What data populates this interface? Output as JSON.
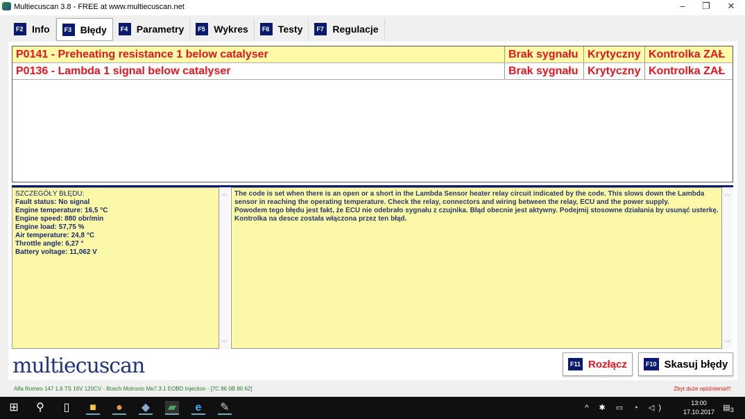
{
  "window": {
    "title": "Multiecuscan 3.8 - FREE at www.multiecuscan.net",
    "minimize": "–",
    "restore": "❐",
    "close": "✕"
  },
  "tabs": [
    {
      "key": "F2",
      "label": "Info"
    },
    {
      "key": "F3",
      "label": "Błędy"
    },
    {
      "key": "F4",
      "label": "Parametry"
    },
    {
      "key": "F5",
      "label": "Wykres"
    },
    {
      "key": "F6",
      "label": "Testy"
    },
    {
      "key": "F7",
      "label": "Regulacje"
    }
  ],
  "faults": [
    {
      "description": "P0141 - Preheating resistance 1 below catalyser",
      "status": "Brak sygnału",
      "severity": "Krytyczny",
      "lamp": "Kontrolka ZAŁ"
    },
    {
      "description": "P0136 - Lambda 1 signal below catalyser",
      "status": "Brak sygnału",
      "severity": "Krytyczny",
      "lamp": "Kontrolka ZAŁ"
    }
  ],
  "details": {
    "heading": "SZCZEGÓŁY BŁĘDU:",
    "lines": [
      "Fault status: No signal",
      "Engine temperature: 16,5 °C",
      "Engine speed: 880 obr/min",
      "Engine load: 57,75 %",
      "Air temperature: 24,8 °C",
      "Throttle angle: 6,27 °",
      "Battery voltage: 11,062 V"
    ]
  },
  "description": {
    "en": "The code is set when there is an open or a short in the Lambda Sensor heater relay circuit indicated by the code. This slows down the Lambda sensor in reaching the operating temperature. Check the relay, connectors and wiring between the relay, ECU and the power supply.",
    "pl": "Powodem tego błędu jest fakt, że ECU nie odebrało sygnału z czujnika. Błąd obecnie jest aktywny. Podejmij stosowne działania by usunąć usterkę. Kontrolka na desce została włączona przez ten błąd."
  },
  "logo": "multiecuscan",
  "buttons": {
    "disconnect_key": "F11",
    "disconnect": "Rozłącz",
    "clear_key": "F10",
    "clear": "Skasuj błędy"
  },
  "status": {
    "vehicle": "Alfa Romeo 147 1.6 TS 16V 120CV - Bosch Motronic Me7.3.1 EOBD Injection - [7C 86 0B 80 62]",
    "warning": "Zbyt duże opóźnienia!!!"
  },
  "taskbar": {
    "time": "13:00",
    "date": "17.10.2017",
    "notifications": "3"
  },
  "colors": {
    "fault_text": "#e8141e",
    "selected_row": "#fdfaa8",
    "panel": "#fbf8a8",
    "accent": "#0a1a6e"
  }
}
